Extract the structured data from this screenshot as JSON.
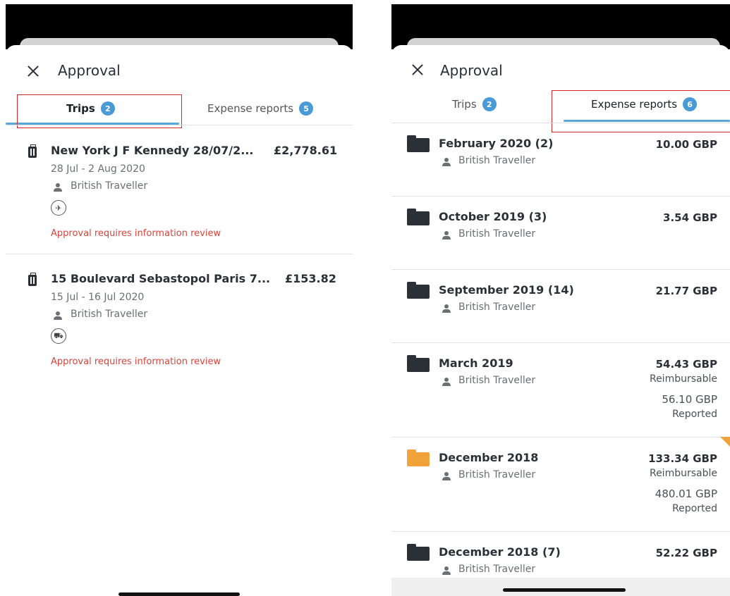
{
  "left": {
    "title": "Approval",
    "tabs": [
      {
        "label": "Trips",
        "count": "2",
        "active": true
      },
      {
        "label": "Expense reports",
        "count": "5",
        "active": false
      }
    ],
    "trips": [
      {
        "title": "New York J F Kennedy 28/07/2...",
        "amount": "£2,778.61",
        "dates": "28 Jul - 2 Aug 2020",
        "traveller": "British Traveller",
        "mode_icon": "plane-icon",
        "warning": "Approval requires information review"
      },
      {
        "title": "15 Boulevard Sebastopol Paris 7...",
        "amount": "£153.82",
        "dates": "15 Jul - 16 Jul 2020",
        "traveller": "British Traveller",
        "mode_icon": "car-icon",
        "warning": "Approval requires information review"
      }
    ]
  },
  "right": {
    "title": "Approval",
    "tabs": [
      {
        "label": "Trips",
        "count": "2",
        "active": false
      },
      {
        "label": "Expense reports",
        "count": "6",
        "active": true
      }
    ],
    "reports": [
      {
        "title": "February 2020 (2)",
        "traveller": "British Traveller",
        "amount": "10.00 GBP",
        "folder_color": "#2b2f36"
      },
      {
        "title": "October 2019 (3)",
        "traveller": "British Traveller",
        "amount": "3.54 GBP",
        "folder_color": "#2b2f36"
      },
      {
        "title": "September 2019 (14)",
        "traveller": "British Traveller",
        "amount": "21.77 GBP",
        "folder_color": "#2b2f36"
      },
      {
        "title": "March 2019",
        "traveller": "British Traveller",
        "amount": "54.43 GBP",
        "amount_label": "Reimbursable",
        "reported": "56.10 GBP",
        "reported_label": "Reported",
        "folder_color": "#2b2f36"
      },
      {
        "title": "December 2018",
        "traveller": "British Traveller",
        "amount": "133.34 GBP",
        "amount_label": "Reimbursable",
        "reported": "480.01 GBP",
        "reported_label": "Reported",
        "folder_color": "#f2a23a"
      },
      {
        "title": "December 2018 (7)",
        "traveller": "British Traveller",
        "amount": "52.22 GBP",
        "folder_color": "#2b2f36"
      }
    ]
  },
  "colors": {
    "accent": "#4a9ad8",
    "warning": "#d9443a",
    "highlight_box": "#d9232d",
    "flag": "#f2a23a"
  }
}
